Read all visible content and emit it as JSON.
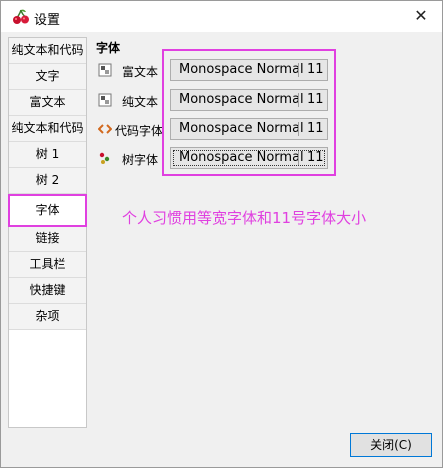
{
  "window": {
    "title": "设置",
    "close_glyph": "✕",
    "app_icon": "cherry-icon"
  },
  "sidebar": {
    "items": [
      {
        "label": "纯文本和代码"
      },
      {
        "label": "文字"
      },
      {
        "label": "富文本"
      },
      {
        "label": "纯文本和代码"
      },
      {
        "label": "树 1"
      },
      {
        "label": "树 2"
      },
      {
        "label": "字体",
        "selected": true
      },
      {
        "label": "链接"
      },
      {
        "label": "工具栏"
      },
      {
        "label": "快捷键"
      },
      {
        "label": "杂项"
      }
    ]
  },
  "fonts": {
    "section_title": "字体",
    "rows": [
      {
        "label": "富文本",
        "font": "Monospace Normal",
        "size": "11",
        "icon": "rich-text-icon"
      },
      {
        "label": "纯文本",
        "font": "Monospace Normal",
        "size": "11",
        "icon": "plain-text-icon"
      },
      {
        "label": "代码字体",
        "font": "Monospace Normal",
        "size": "11",
        "icon": "code-icon"
      },
      {
        "label": "树字体",
        "font": "Monospace Normal",
        "size": "11",
        "icon": "tree-icon"
      }
    ]
  },
  "annotation": "个人习惯用等宽字体和11号字体大小",
  "footer": {
    "close_label": "关闭(C)"
  },
  "colors": {
    "annotation": "#e040e0",
    "selection_border": "#e040e0",
    "button_focus": "#0078d7"
  }
}
